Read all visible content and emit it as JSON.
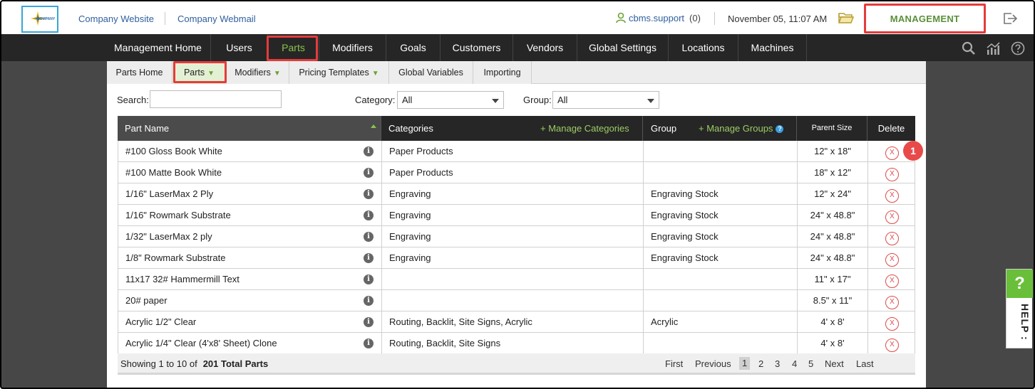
{
  "topbar": {
    "logo_text": "COMPANY",
    "links": [
      "Company Website",
      "Company Webmail"
    ],
    "user": "cbms.support",
    "user_count": "(0)",
    "datetime": "November 05, 11:07 AM",
    "management_label": "MANAGEMENT"
  },
  "nav": {
    "items": [
      "Management Home",
      "Users",
      "Parts",
      "Modifiers",
      "Goals",
      "Customers",
      "Vendors",
      "Global Settings",
      "Locations",
      "Machines"
    ],
    "active": "Parts"
  },
  "subnav": {
    "items": [
      "Parts Home",
      "Parts",
      "Modifiers",
      "Pricing Templates",
      "Global Variables",
      "Importing"
    ],
    "active": "Parts"
  },
  "filters": {
    "search_label": "Search:",
    "search_value": "",
    "category_label": "Category:",
    "category_value": "All",
    "group_label": "Group:",
    "group_value": "All"
  },
  "table": {
    "headers": {
      "part_name": "Part Name",
      "categories": "Categories",
      "manage_categories": "+ Manage Categories",
      "group": "Group",
      "manage_groups": "+ Manage Groups",
      "parent_size": "Parent Size",
      "delete": "Delete"
    },
    "rows": [
      {
        "name": "#100 Gloss Book White",
        "categories": "Paper Products",
        "group": "",
        "size": "12\" x 18\""
      },
      {
        "name": "#100 Matte Book White",
        "categories": "Paper Products",
        "group": "",
        "size": "18\" x 12\""
      },
      {
        "name": "1/16\" LaserMax 2 Ply",
        "categories": "Engraving",
        "group": "Engraving Stock",
        "size": "12\" x 24\""
      },
      {
        "name": "1/16\" Rowmark Substrate",
        "categories": "Engraving",
        "group": "Engraving Stock",
        "size": "24\" x 48.8\""
      },
      {
        "name": "1/32\" LaserMax 2 ply",
        "categories": "Engraving",
        "group": "Engraving Stock",
        "size": "24\" x 48.8\""
      },
      {
        "name": "1/8\" Rowmark Substrate",
        "categories": "Engraving",
        "group": "Engraving Stock",
        "size": "24\" x 48.8\""
      },
      {
        "name": "11x17 32# Hammermill Text",
        "categories": "",
        "group": "",
        "size": "11\" x 17\""
      },
      {
        "name": "20# paper",
        "categories": "",
        "group": "",
        "size": "8.5\" x 11\""
      },
      {
        "name": "Acrylic 1/2\" Clear",
        "categories": "Routing, Backlit, Site Signs, Acrylic",
        "group": "Acrylic",
        "size": "4' x 8'"
      },
      {
        "name": "Acrylic 1/4\" Clear (4'x8' Sheet) Clone",
        "categories": "Routing, Backlit, Site Signs",
        "group": "",
        "size": "4' x 8'"
      }
    ],
    "delete_glyph": "X",
    "info_glyph": "i"
  },
  "footer": {
    "showing": "Showing 1 to 10 of",
    "total": "201 Total Parts",
    "pager": [
      "First",
      "Previous",
      "1",
      "2",
      "3",
      "4",
      "5",
      "Next",
      "Last"
    ],
    "current_page": "1"
  },
  "annotation_badge": "1",
  "help": {
    "icon": "?",
    "label": "HELP :"
  },
  "colors": {
    "accent_green": "#8bc34a",
    "highlight_red": "#e53b3b",
    "nav_dark": "#262626"
  }
}
